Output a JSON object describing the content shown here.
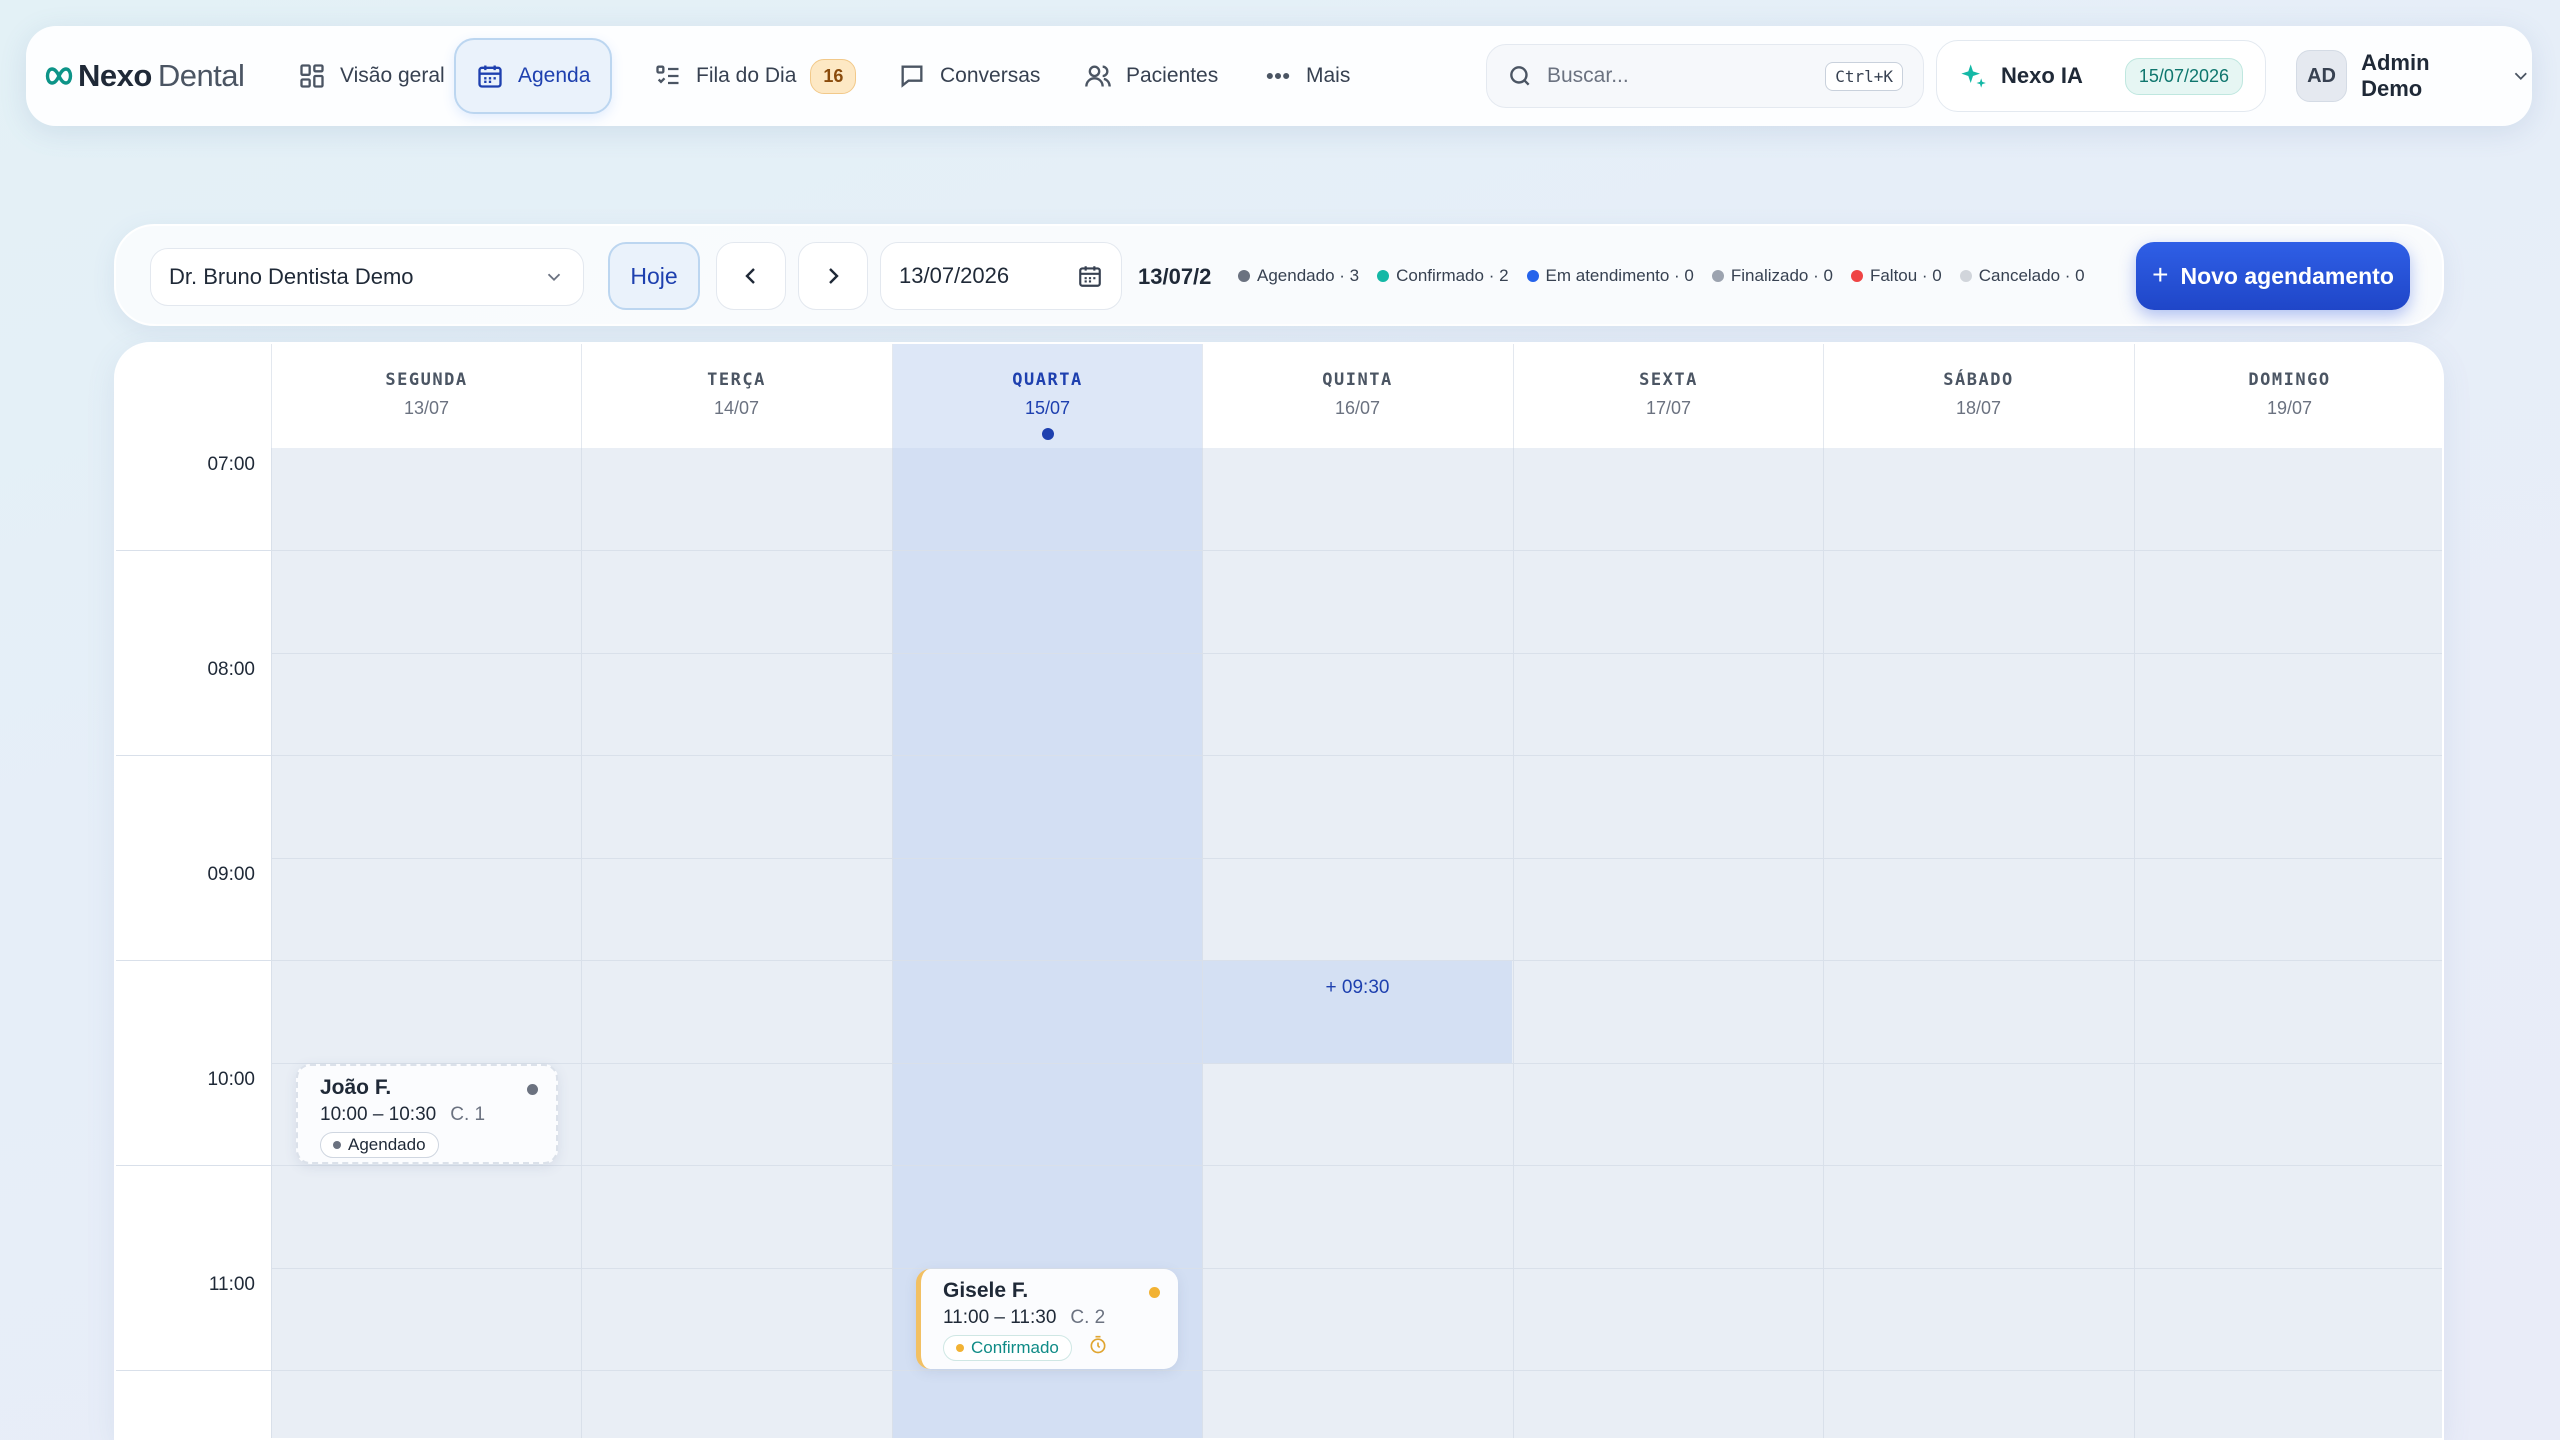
{
  "brand": {
    "name_a": "Nexo",
    "name_b": "Dental"
  },
  "nav": [
    {
      "label": "Visão geral",
      "icon": "dashboard-icon"
    },
    {
      "label": "Agenda",
      "icon": "calendar-icon",
      "active": true
    },
    {
      "label": "Fila do Dia",
      "icon": "list-check-icon",
      "badge": "16"
    },
    {
      "label": "Conversas",
      "icon": "chat-icon"
    },
    {
      "label": "Pacientes",
      "icon": "users-icon"
    },
    {
      "label": "Mais",
      "icon": "more-icon"
    }
  ],
  "search": {
    "placeholder": "Buscar...",
    "shortcut": "Ctrl+K"
  },
  "ai": {
    "label": "Nexo IA",
    "date": "15/07/2026"
  },
  "user": {
    "initials": "AD",
    "name": "Admin Demo"
  },
  "toolbar": {
    "dentist": "Dr. Bruno Dentista Demo",
    "today_label": "Hoje",
    "date_value": "13/07/2026",
    "range_text": "13/07/2",
    "new_label": "Novo agendamento"
  },
  "legend": [
    {
      "label": "Agendado · 3",
      "color": "#6b7280"
    },
    {
      "label": "Confirmado · 2",
      "color": "#14b8a6"
    },
    {
      "label": "Em atendimento · 0",
      "color": "#2563eb"
    },
    {
      "label": "Finalizado · 0",
      "color": "#9ca3af"
    },
    {
      "label": "Faltou · 0",
      "color": "#ef4444"
    },
    {
      "label": "Cancelado · 0",
      "color": "#d1d5db"
    }
  ],
  "days": [
    {
      "name": "SEGUNDA",
      "date": "13/07"
    },
    {
      "name": "TERÇA",
      "date": "14/07"
    },
    {
      "name": "QUARTA",
      "date": "15/07",
      "today": true
    },
    {
      "name": "QUINTA",
      "date": "16/07"
    },
    {
      "name": "SEXTA",
      "date": "17/07"
    },
    {
      "name": "SÁBADO",
      "date": "18/07"
    },
    {
      "name": "DOMINGO",
      "date": "19/07"
    }
  ],
  "times": [
    "07:00",
    "08:00",
    "09:00",
    "10:00",
    "11:00"
  ],
  "slot_hover": "+ 09:30",
  "appointments": [
    {
      "name": "João F.",
      "time": "10:00 – 10:30",
      "room": "C. 1",
      "status": "Agendado",
      "dot_color": "#6b7280"
    },
    {
      "name": "Gisele F.",
      "time": "11:00 – 11:30",
      "room": "C. 2",
      "status": "Confirmado",
      "dot_color": "#f2b233"
    }
  ]
}
